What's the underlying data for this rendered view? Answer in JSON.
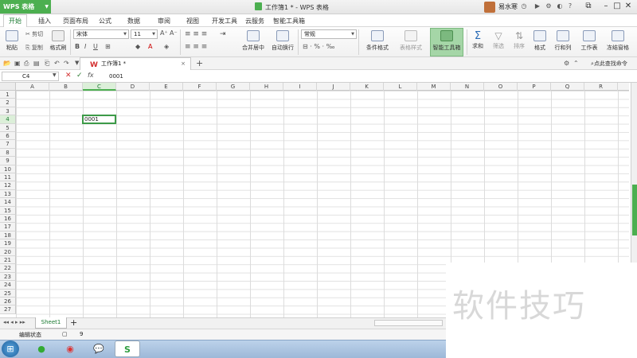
{
  "titlebar": {
    "app_menu": "WPS 表格",
    "doc_title": "工作簿1 * - WPS 表格",
    "user_name": "易水寒"
  },
  "tabs": [
    "开始",
    "插入",
    "页面布局",
    "公式",
    "数据",
    "审阅",
    "视图",
    "开发工具",
    "云服务",
    "智能工具箱"
  ],
  "ribbon": {
    "paste": "粘贴",
    "cut": "剪切",
    "copy": "复制",
    "format_painter": "格式刷",
    "font": "宋体",
    "font_size": "11",
    "merge_center": "合并居中",
    "wrap_text": "自动换行",
    "number_format": "常规",
    "conditional_format": "条件格式",
    "table_style": "表格样式",
    "smart_toolbox": "智能工具箱",
    "sum": "求和",
    "filter": "筛选",
    "sort": "排序",
    "format": "格式",
    "row_col": "行和列",
    "worksheet": "工作表",
    "freeze": "冻结窗格"
  },
  "doc_tab": {
    "label": "工作簿1 *",
    "find_command": "点此查找命令"
  },
  "formula_bar": {
    "name_box": "C4",
    "fx": "fx",
    "content": "0001"
  },
  "columns": [
    "A",
    "B",
    "C",
    "D",
    "E",
    "F",
    "G",
    "H",
    "I",
    "J",
    "K",
    "L",
    "M",
    "N",
    "O",
    "P",
    "Q",
    "R"
  ],
  "rows": [
    "1",
    "2",
    "3",
    "4",
    "5",
    "6",
    "7",
    "8",
    "9",
    "10",
    "11",
    "12",
    "13",
    "14",
    "15",
    "16",
    "17",
    "18",
    "19",
    "20",
    "21",
    "22",
    "23",
    "24",
    "25",
    "26",
    "27"
  ],
  "active_cell": {
    "value": "0001"
  },
  "sheet_tab": "Sheet1",
  "status": {
    "mode": "编辑状态",
    "count": "9"
  },
  "watermark": "软件技巧"
}
